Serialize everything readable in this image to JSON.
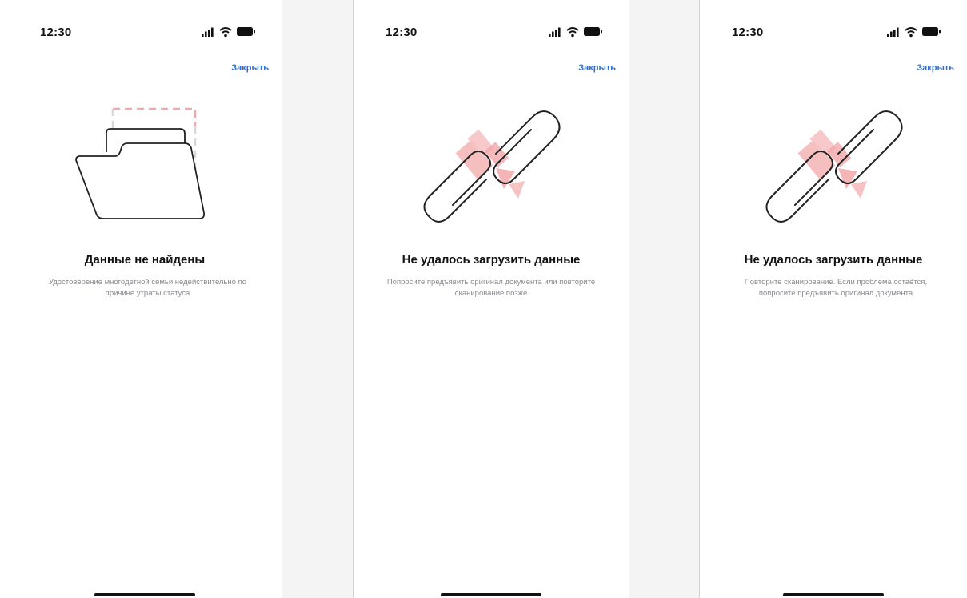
{
  "screens": [
    {
      "time": "12:30",
      "close_label": "Закрыть",
      "illustration_icon": "empty-folder-icon",
      "title": "Данные не найдены",
      "description": "Удостоверение многодетной семьи недействительно по причине утраты статуса"
    },
    {
      "time": "12:30",
      "close_label": "Закрыть",
      "illustration_icon": "broken-link-icon",
      "title": "Не удалось загрузить данные",
      "description": "Попросите предъявить оригинал документа или повторите сканирование позже"
    },
    {
      "time": "12:30",
      "close_label": "Закрыть",
      "illustration_icon": "broken-link-icon",
      "title": "Не удалось загрузить данные",
      "description": "Повторите сканирование. Если проблема остаётся, попросите предъявить оригинал документа"
    }
  ],
  "colors": {
    "accent": "#2f6fd0",
    "illustration_highlight": "#f2a8aa",
    "text_primary": "#111111",
    "text_secondary": "#8a8a8f"
  }
}
